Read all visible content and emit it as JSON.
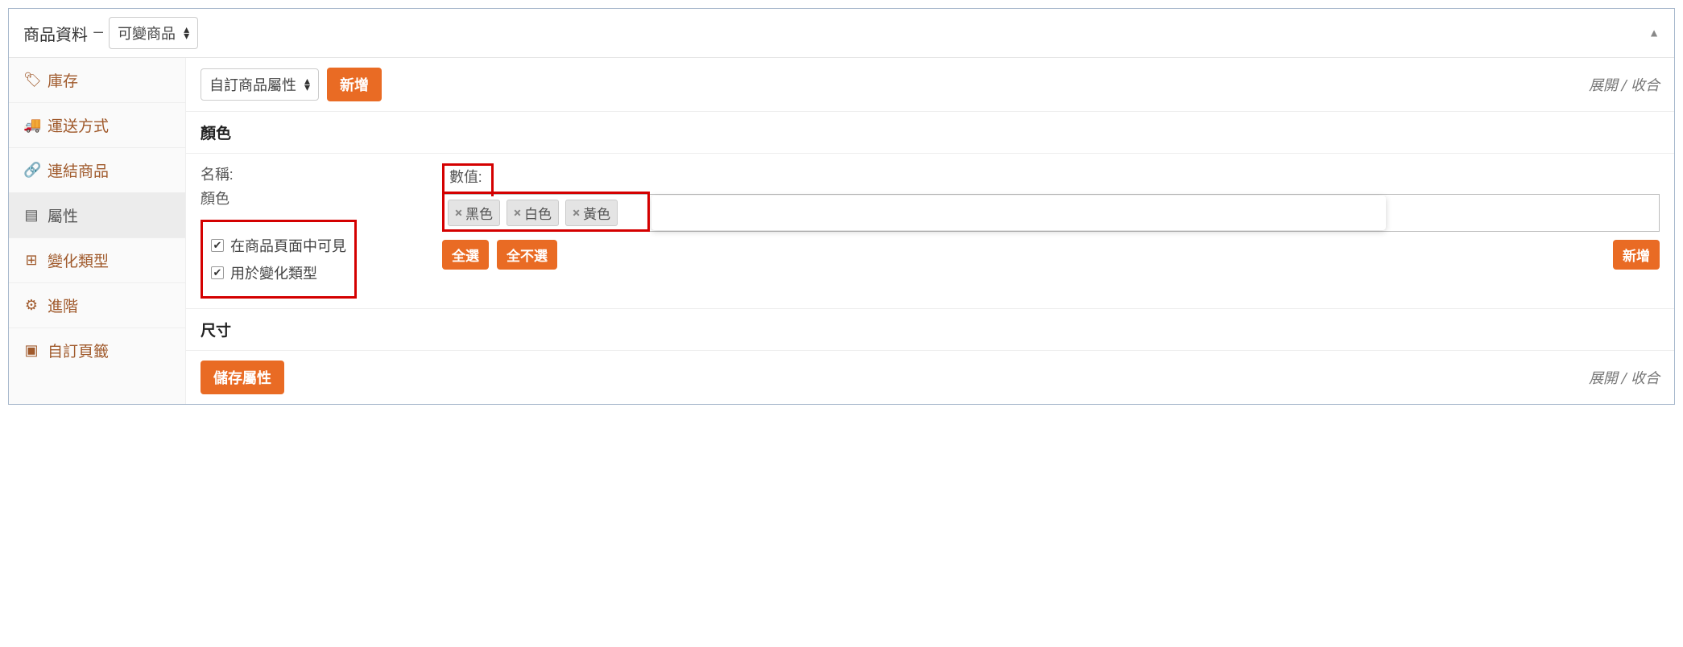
{
  "header": {
    "title": "商品資料",
    "dash": "—",
    "product_type": "可變商品"
  },
  "sidebar": {
    "items": [
      {
        "label": "庫存"
      },
      {
        "label": "運送方式"
      },
      {
        "label": "連結商品"
      },
      {
        "label": "屬性"
      },
      {
        "label": "變化類型"
      },
      {
        "label": "進階"
      },
      {
        "label": "自訂頁籤"
      }
    ]
  },
  "toolbar": {
    "attribute_select": "自訂商品屬性",
    "add_button": "新增",
    "expand": "展開",
    "slash": " / ",
    "collapse": "收合"
  },
  "attribute": {
    "section_title_color": "顏色",
    "name_label": "名稱:",
    "name_value": "顏色",
    "visible_label": "在商品頁面中可見",
    "variation_label": "用於變化類型",
    "values_label": "數值:",
    "tags": [
      "黑色",
      "白色",
      "黃色"
    ],
    "select_all": "全選",
    "select_none": "全不選",
    "add_new": "新增",
    "section_title_size": "尺寸"
  },
  "footer": {
    "save_button": "儲存屬性"
  }
}
